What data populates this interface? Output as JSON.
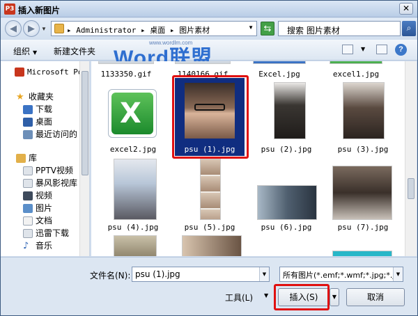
{
  "window": {
    "title": "插入新图片",
    "app_badge": "P3",
    "close_label": "✕"
  },
  "address": {
    "path": "▸ Administrator ▸ 桌面 ▸ 图片素材",
    "search_placeholder": "搜索 图片素材"
  },
  "toolbar": {
    "organize": "组织",
    "new_folder": "新建文件夹"
  },
  "watermark": {
    "brand": "Word",
    "brand_cn": "联盟",
    "url": "www.wordlm.com"
  },
  "nav": {
    "items": [
      {
        "label": "Microsoft Po"
      },
      {
        "label": "收藏夹"
      },
      {
        "label": "下载"
      },
      {
        "label": "桌面"
      },
      {
        "label": "最近访问的"
      },
      {
        "label": "库"
      },
      {
        "label": "PPTV视频"
      },
      {
        "label": "暴风影视库"
      },
      {
        "label": "视频"
      },
      {
        "label": "图片"
      },
      {
        "label": "文档"
      },
      {
        "label": "迅雷下载"
      },
      {
        "label": "音乐"
      }
    ]
  },
  "files": [
    {
      "name": "1133350.gif"
    },
    {
      "name": "1140166.gif"
    },
    {
      "name": "Excel.jpg"
    },
    {
      "name": "excel1.jpg"
    },
    {
      "name": "excel2.jpg"
    },
    {
      "name": "psu (1).jpg"
    },
    {
      "name": "psu (2).jpg"
    },
    {
      "name": "psu (3).jpg"
    },
    {
      "name": "psu (4).jpg"
    },
    {
      "name": "psu (5).jpg"
    },
    {
      "name": "psu (6).jpg"
    },
    {
      "name": "psu (7).jpg"
    }
  ],
  "bottom": {
    "filename_label": "文件名(N):",
    "filename_value": "psu (1).jpg",
    "filetype_value": "所有图片(*.emf;*.wmf;*.jpg;*.jp",
    "tools_label": "工具(L)",
    "insert_label": "插入(S)",
    "cancel_label": "取消"
  },
  "colors": {
    "selection": "#102d80",
    "highlight_box": "#e01010"
  }
}
